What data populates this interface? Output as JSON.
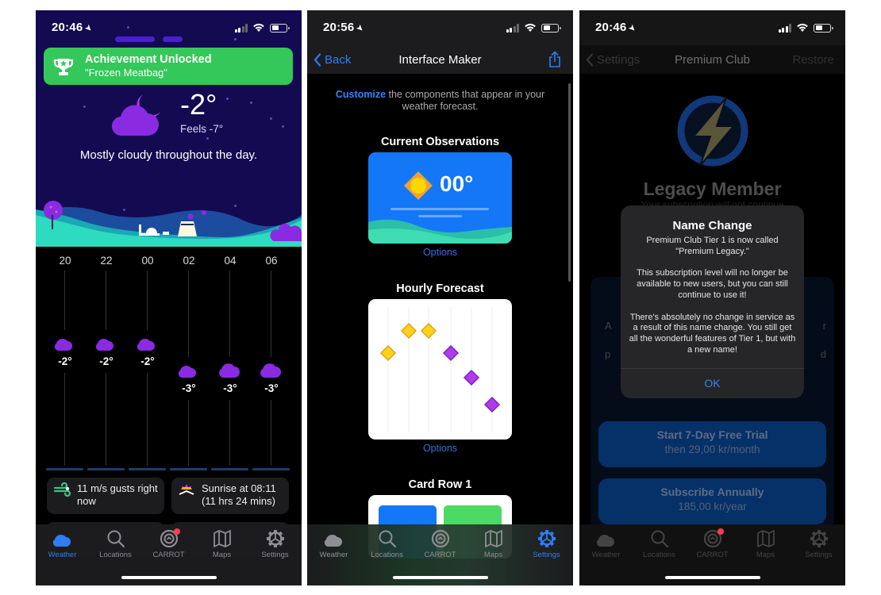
{
  "screens": [
    {
      "id": "weather",
      "status": {
        "time": "20:46"
      },
      "achievement": {
        "title": "Achievement Unlocked",
        "subtitle": "\"Frozen Meatbag\""
      },
      "current": {
        "temp": "-2°",
        "feels": "Feels -7°",
        "summary": "Mostly cloudy throughout the day.",
        "icon": "cloudy-night-icon"
      },
      "hourly": [
        {
          "hour": "20",
          "temp": "-2°",
          "icon": "partly-cloudy-night-icon"
        },
        {
          "hour": "22",
          "temp": "-2°",
          "icon": "partly-cloudy-night-icon"
        },
        {
          "hour": "00",
          "temp": "-2°",
          "icon": "partly-cloudy-night-icon"
        },
        {
          "hour": "02",
          "temp": "-3°",
          "icon": "partly-cloudy-night-icon"
        },
        {
          "hour": "04",
          "temp": "-3°",
          "icon": "cloudy-night-icon"
        },
        {
          "hour": "06",
          "temp": "-3°",
          "icon": "cloudy-night-icon"
        }
      ],
      "cards": [
        {
          "text": "11 m/s gusts right now",
          "icon": "wind-icon"
        },
        {
          "text": "Sunrise at 08:11 (11 hrs 24 mins)",
          "icon": "sunrise-icon"
        }
      ],
      "active_tab": "Weather"
    },
    {
      "id": "interface-maker",
      "status": {
        "time": "20:56"
      },
      "nav": {
        "back": "Back",
        "title": "Interface Maker",
        "action": "share-icon"
      },
      "intro": {
        "highlight": "Customize",
        "rest": " the components that appear in your weather forecast."
      },
      "sections": [
        {
          "title": "Current Observations",
          "preview_temp": "00°",
          "options": "Options"
        },
        {
          "title": "Hourly Forecast",
          "options": "Options"
        },
        {
          "title": "Card Row 1"
        }
      ],
      "active_tab": "Settings"
    },
    {
      "id": "premium-club",
      "status": {
        "time": "20:46"
      },
      "nav": {
        "back": "Settings",
        "title": "Premium Club",
        "action": "Restore"
      },
      "heading": "Legacy Member",
      "subheading": "Your subscription will not continue",
      "alert": {
        "title": "Name Change",
        "message": "Premium Club Tier 1 is now called \"Premium Legacy.\"\n\nThis subscription level will no longer be available to new users, but you can still continue to use it!\n\nThere's absolutely no change in service as a result of this name change. You still get all the wonderful features of Tier 1, but with a new name!",
        "button": "OK"
      },
      "buttons": [
        {
          "title": "Start 7-Day Free Trial",
          "subtitle": "then 29,00 kr/month"
        },
        {
          "title": "Subscribe Annually",
          "subtitle": "185,00 kr/year"
        }
      ],
      "active_tab": null
    }
  ],
  "tabs": [
    {
      "label": "Weather",
      "icon": "weather-icon"
    },
    {
      "label": "Locations",
      "icon": "search-icon"
    },
    {
      "label": "CARROT",
      "icon": "carrot-icon"
    },
    {
      "label": "Maps",
      "icon": "map-icon"
    },
    {
      "label": "Settings",
      "icon": "gear-icon"
    }
  ],
  "colors": {
    "accent": "#2f7cf6",
    "achievement": "#34c759",
    "sky": "#130a52",
    "purple": "#8a2be2"
  }
}
